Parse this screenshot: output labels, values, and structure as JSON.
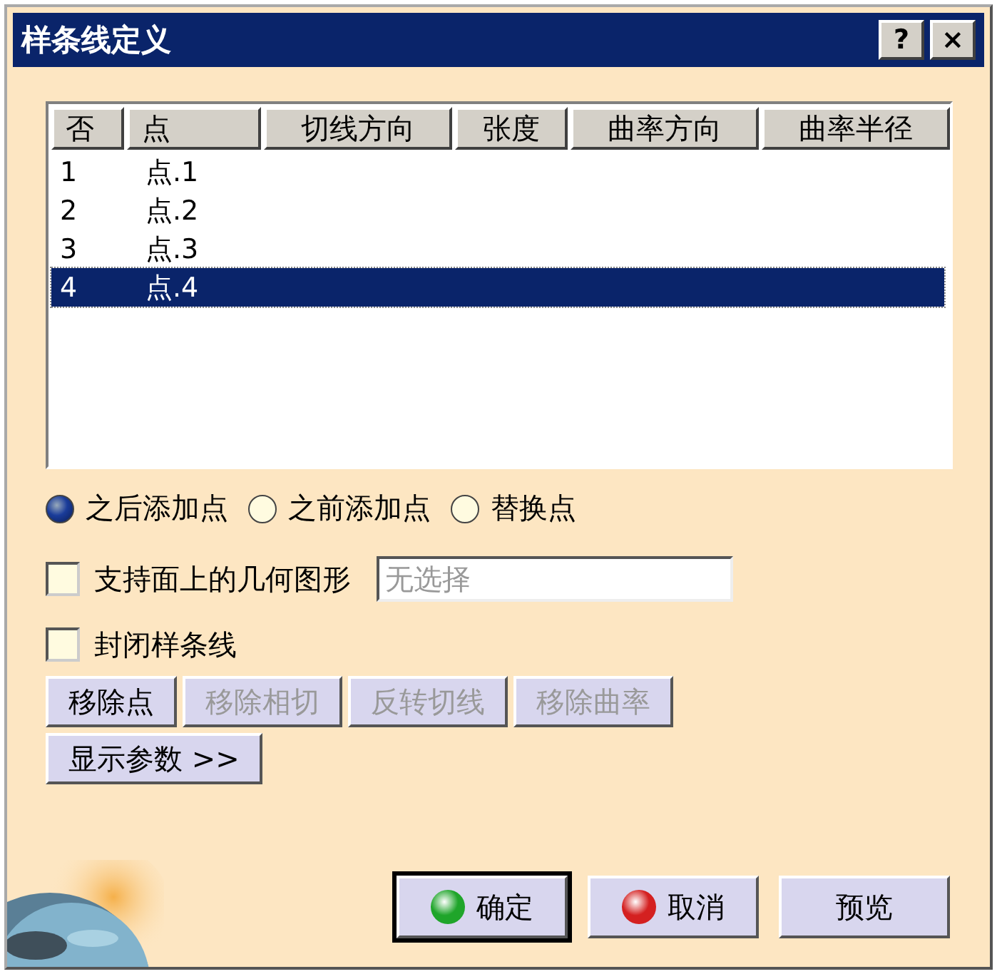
{
  "window": {
    "title": "样条线定义",
    "buttons": [
      {
        "label": "?"
      },
      {
        "label": "×"
      }
    ]
  },
  "table": {
    "columns": [
      "否",
      "点",
      "切线方向",
      "张度",
      "曲率方向",
      "曲率半径"
    ],
    "rows": [
      {
        "cells": [
          "1",
          "点.1"
        ],
        "selected": false
      },
      {
        "cells": [
          "2",
          "点.2"
        ],
        "selected": false
      },
      {
        "cells": [
          "3",
          "点.3"
        ],
        "selected": false
      },
      {
        "cells": [
          "4",
          "点.4"
        ],
        "selected": true
      }
    ]
  },
  "add_mode": [
    {
      "label": "之后添加点",
      "selected": true
    },
    {
      "label": "之前添加点",
      "selected": false
    },
    {
      "label": "替换点",
      "selected": false
    }
  ],
  "support": {
    "label": "支持面上的几何图形",
    "checked": false,
    "placeholder": "无选择"
  },
  "close_spline": {
    "label": "封闭样条线",
    "checked": false
  },
  "point_buttons": [
    {
      "label": "移除点",
      "disabled": false
    },
    {
      "label": "移除相切",
      "disabled": true
    },
    {
      "label": "反转切线",
      "disabled": true
    },
    {
      "label": "移除曲率",
      "disabled": true
    }
  ],
  "params_button": {
    "label": "显示参数 >>"
  },
  "dialog_buttons": [
    {
      "kind": "ok",
      "label": "确定",
      "default": true
    },
    {
      "kind": "cancel",
      "label": "取消",
      "default": false
    },
    {
      "kind": "plain",
      "label": "预览",
      "default": false
    }
  ]
}
